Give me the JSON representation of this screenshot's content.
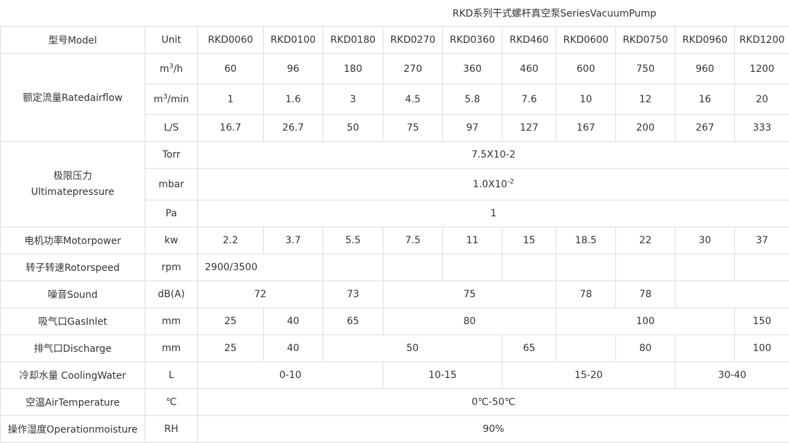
{
  "title": "RKD系列干式螺杆真空泵SeriesVacuumPump",
  "header": {
    "model_label": "型号Model",
    "unit_label": "Unit",
    "models": [
      "RKD0060",
      "RKD0100",
      "RKD0180",
      "RKD0270",
      "RKD0360",
      "RKD460",
      "RKD0600",
      "RKD0750",
      "RKD0960",
      "RKD1200"
    ]
  },
  "airflow": {
    "label": "额定流量Ratedairflow",
    "rows": [
      {
        "unit_base": "m",
        "unit_exp": "3",
        "unit_tail": "/h",
        "values": [
          "60",
          "96",
          "180",
          "270",
          "360",
          "460",
          "600",
          "750",
          "960",
          "1200"
        ]
      },
      {
        "unit_base": "m",
        "unit_exp": "3",
        "unit_tail": "/min",
        "values": [
          "1",
          "1.6",
          "3",
          "4.5",
          "5.8",
          "7.6",
          "10",
          "12",
          "16",
          "20"
        ]
      },
      {
        "unit": "L/S",
        "values": [
          "16.7",
          "26.7",
          "50",
          "75",
          "97",
          "127",
          "167",
          "200",
          "267",
          "333"
        ]
      }
    ]
  },
  "pressure": {
    "label_cn": "极限压力",
    "label_en": "Ultimatepressure",
    "torr_unit": "Torr",
    "torr_value": "7.5X10-2",
    "mbar_unit": "mbar",
    "mbar_base": "1.0X10",
    "mbar_exp": "-2",
    "pa_unit": "Pa",
    "pa_value": "1"
  },
  "motor": {
    "label": "电机功率Motorpower",
    "unit": "kw",
    "values": [
      "2.2",
      "3.7",
      "5.5",
      "7.5",
      "11",
      "15",
      "18.5",
      "22",
      "30",
      "37"
    ]
  },
  "rotor": {
    "label": "转子转速Rotorspeed",
    "unit": "rpm",
    "value": "2900/3500"
  },
  "sound": {
    "label": "噪音Sound",
    "unit": "dB(A)",
    "v1": "72",
    "v2": "73",
    "v3": "75",
    "v4": "78",
    "v5": "78"
  },
  "inlet": {
    "label": "吸气口GasInlet",
    "unit": "mm",
    "v1": "25",
    "v2": "40",
    "v3": "65",
    "v4": "80",
    "v5": "100",
    "v6": "150"
  },
  "discharge": {
    "label": "排气口Discharge",
    "unit": "mm",
    "v1": "25",
    "v2": "40",
    "v3": "50",
    "v4": "65",
    "v5": "80",
    "v6": "100"
  },
  "cooling": {
    "label": "冷却水量 CoolingWater",
    "unit": "L",
    "v1": "0-10",
    "v2": "10-15",
    "v3": "15-20",
    "v4": "30-40"
  },
  "air_temp": {
    "label": "空温AirTemperature",
    "unit": "℃",
    "value": "0℃-50℃"
  },
  "humidity": {
    "label": "操作湿度Operationmoisture",
    "unit": "RH",
    "value": "90%"
  }
}
